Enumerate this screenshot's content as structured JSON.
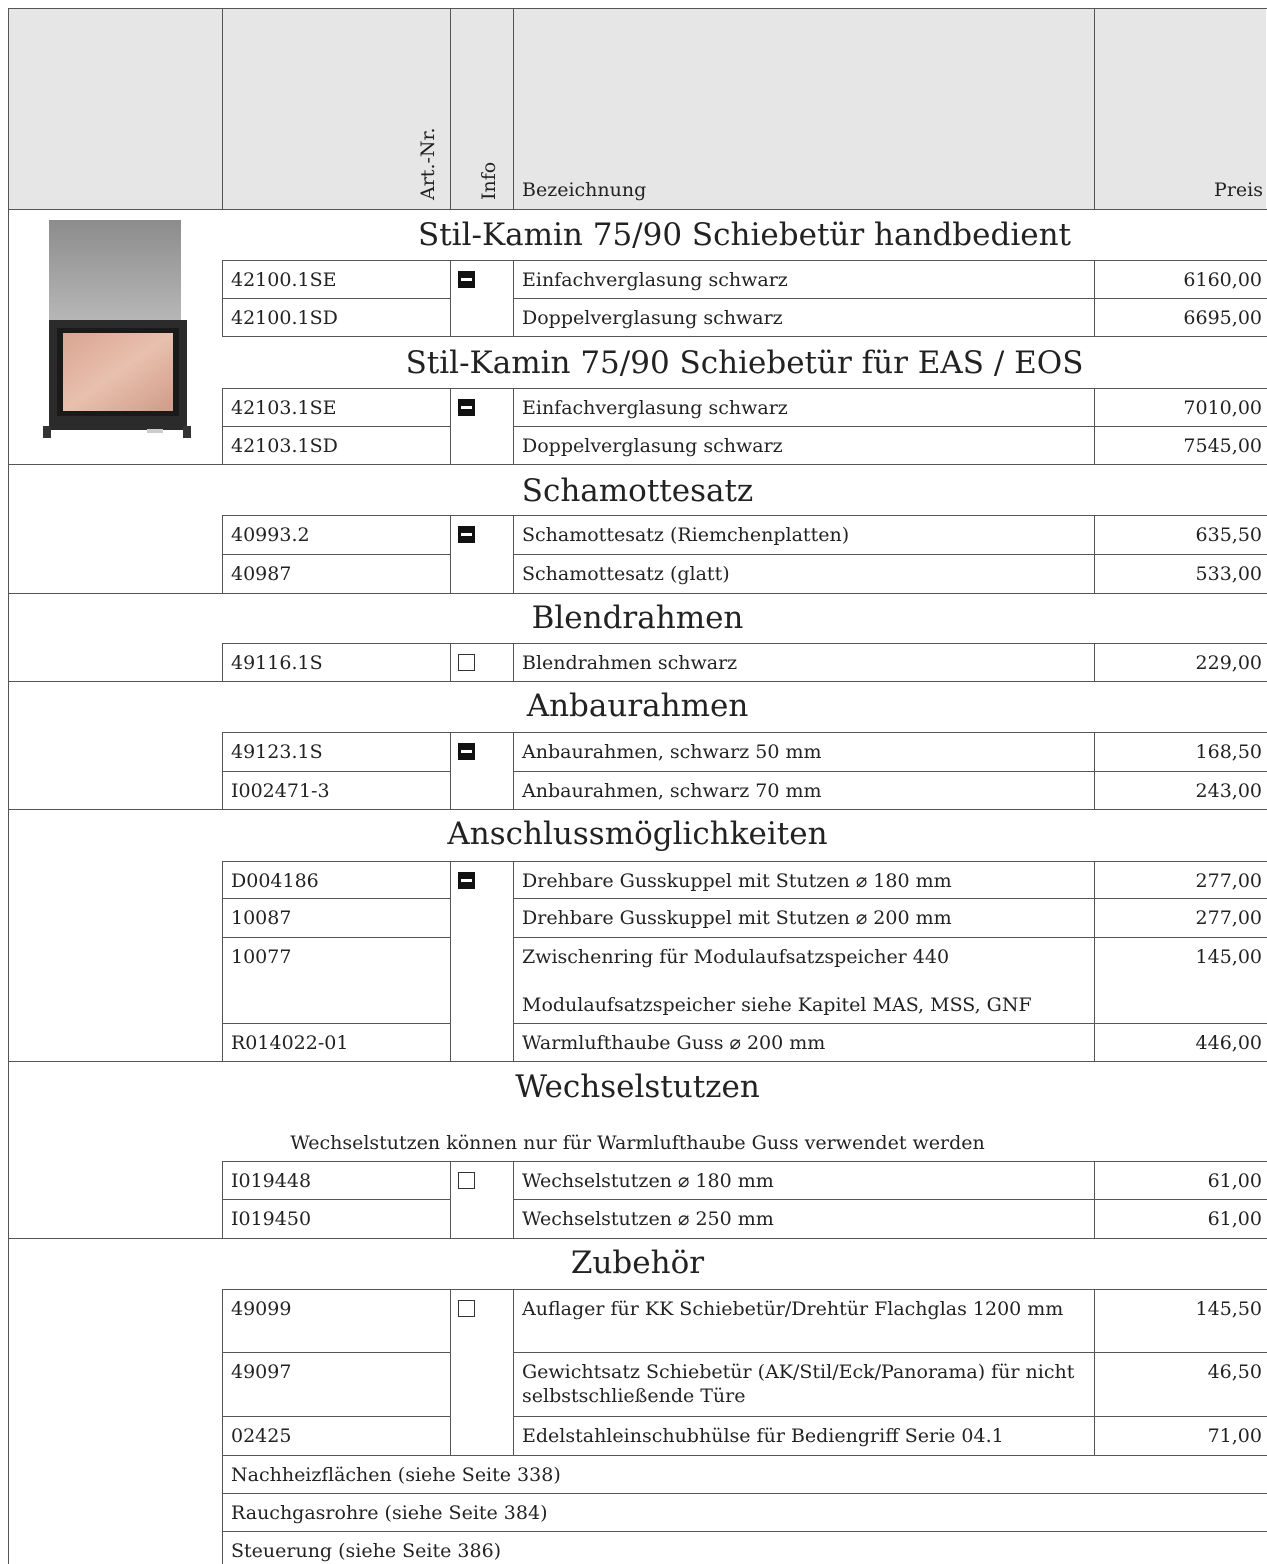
{
  "header": {
    "col_artnr": "Art.-Nr.",
    "col_info": "Info",
    "col_bezeichnung": "Bezeichnung",
    "col_preis": "Preis"
  },
  "product_image": {
    "icon": "fireplace-product-image"
  },
  "sections": {
    "kamin_hand": {
      "title": "Stil-Kamin 75/90 Schiebetür handbedient",
      "info": "filled",
      "rows": [
        {
          "artnr": "42100.1SE",
          "bezeichnung": "Einfachverglasung schwarz",
          "preis": "6160,00"
        },
        {
          "artnr": "42100.1SD",
          "bezeichnung": "Doppelverglasung schwarz",
          "preis": "6695,00"
        }
      ]
    },
    "kamin_eas": {
      "title": "Stil-Kamin 75/90 Schiebetür für EAS / EOS",
      "info": "filled",
      "rows": [
        {
          "artnr": "42103.1SE",
          "bezeichnung": "Einfachverglasung schwarz",
          "preis": "7010,00"
        },
        {
          "artnr": "42103.1SD",
          "bezeichnung": "Doppelverglasung schwarz",
          "preis": "7545,00"
        }
      ]
    },
    "schamottesatz": {
      "title": "Schamottesatz",
      "info": "filled",
      "rows": [
        {
          "artnr": "40993.2",
          "bezeichnung": "Schamottesatz (Riemchenplatten)",
          "preis": "635,50"
        },
        {
          "artnr": "40987",
          "bezeichnung": "Schamottesatz (glatt)",
          "preis": "533,00"
        }
      ]
    },
    "blendrahmen": {
      "title": "Blendrahmen",
      "info": "empty",
      "rows": [
        {
          "artnr": "49116.1S",
          "bezeichnung": "Blendrahmen schwarz",
          "preis": "229,00"
        }
      ]
    },
    "anbaurahmen": {
      "title": "Anbaurahmen",
      "info": "filled",
      "rows": [
        {
          "artnr": "49123.1S",
          "bezeichnung": "Anbaurahmen, schwarz 50 mm",
          "preis": "168,50"
        },
        {
          "artnr": "I002471-3",
          "bezeichnung": "Anbaurahmen, schwarz 70 mm",
          "preis": "243,00"
        }
      ]
    },
    "anschluss": {
      "title": "Anschlussmöglichkeiten",
      "info": "filled",
      "rows": [
        {
          "artnr": "D004186",
          "bezeichnung": "Drehbare Gusskuppel mit Stutzen ⌀ 180 mm",
          "preis": "277,00"
        },
        {
          "artnr": "10087",
          "bezeichnung": "Drehbare Gusskuppel mit Stutzen ⌀ 200 mm",
          "preis": "277,00"
        },
        {
          "artnr": "10077",
          "bezeichnung": "Zwischenring für Modulaufsatzspeicher 440",
          "bezeichnung2": "Modulaufsatzspeicher siehe Kapitel MAS, MSS, GNF",
          "preis": "145,00"
        },
        {
          "artnr": "R014022-01",
          "bezeichnung": "Warmlufthaube Guss ⌀ 200 mm",
          "preis": "446,00"
        }
      ]
    },
    "wechselstutzen": {
      "title": "Wechselstutzen",
      "note": "Wechselstutzen können nur für Warmlufthaube Guss verwendet werden",
      "info": "empty",
      "rows": [
        {
          "artnr": "I019448",
          "bezeichnung": "Wechselstutzen ⌀ 180 mm",
          "preis": "61,00"
        },
        {
          "artnr": "I019450",
          "bezeichnung": "Wechselstutzen ⌀ 250 mm",
          "preis": "61,00"
        }
      ]
    },
    "zubehoer": {
      "title": "Zubehör",
      "info": "empty",
      "rows": [
        {
          "artnr": "49099",
          "bezeichnung": "Auflager für KK Schiebetür/Drehtür Flachglas 1200 mm",
          "preis": "145,50"
        },
        {
          "artnr": "49097",
          "bezeichnung": "Gewichtsatz Schiebetür (AK/Stil/Eck/Panorama) für nicht selbstschließende Türe",
          "preis": "46,50"
        },
        {
          "artnr": "02425",
          "bezeichnung": "Edelstahleinschubhülse für Bediengriff Serie 04.1",
          "preis": "71,00"
        }
      ],
      "links": [
        "Nachheizflächen (siehe Seite 338)",
        "Rauchgasrohre (siehe Seite 384)",
        "Steuerung (siehe Seite 386)"
      ]
    }
  }
}
